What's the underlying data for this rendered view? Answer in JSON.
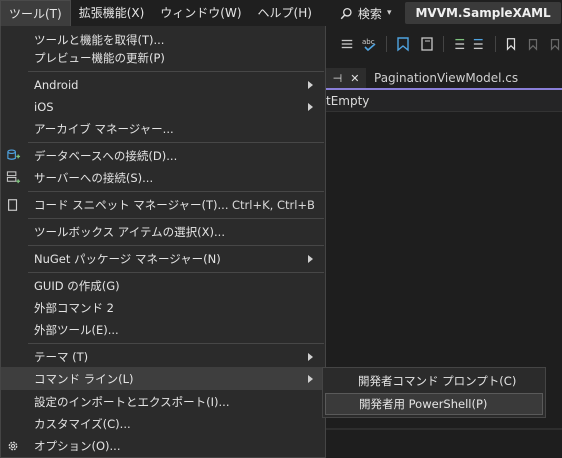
{
  "menubar": {
    "items": [
      "ツール(T)",
      "拡張機能(X)",
      "ウィンドウ(W)",
      "ヘルプ(H)"
    ],
    "search_label": "検索",
    "solution_title": "MVVM.SampleXAML"
  },
  "tabs": {
    "document_tab": "PaginationViewModel.cs",
    "code_fragment": "tEmpty"
  },
  "tools_menu": {
    "items": [
      {
        "label": "ツールと機能を取得(T)..."
      },
      {
        "label": "プレビュー機能の更新(P)"
      },
      {
        "label": "Android"
      },
      {
        "label": "iOS"
      },
      {
        "label": "アーカイブ マネージャー..."
      },
      {
        "label": "データベースへの接続(D)..."
      },
      {
        "label": "サーバーへの接続(S)..."
      },
      {
        "label": "コード スニペット マネージャー(T)...",
        "shortcut": "Ctrl+K, Ctrl+B"
      },
      {
        "label": "ツールボックス アイテムの選択(X)..."
      },
      {
        "label": "NuGet パッケージ マネージャー(N)"
      },
      {
        "label": "GUID の作成(G)"
      },
      {
        "label": "外部コマンド 2"
      },
      {
        "label": "外部ツール(E)..."
      },
      {
        "label": "テーマ (T)"
      },
      {
        "label": "コマンド ライン(L)"
      },
      {
        "label": "設定のインポートとエクスポート(I)..."
      },
      {
        "label": "カスタマイズ(C)..."
      },
      {
        "label": "オプション(O)..."
      }
    ]
  },
  "command_line_submenu": {
    "items": [
      {
        "label": "開発者コマンド プロンプト(C)"
      },
      {
        "label": "開発者用 PowerShell(P)"
      }
    ]
  },
  "colors": {
    "menu_bg": "#2b2b2b",
    "highlight": "#3e3e3e",
    "accent_tab": "#8a7fd8",
    "title_bg": "#3a3a3a"
  }
}
